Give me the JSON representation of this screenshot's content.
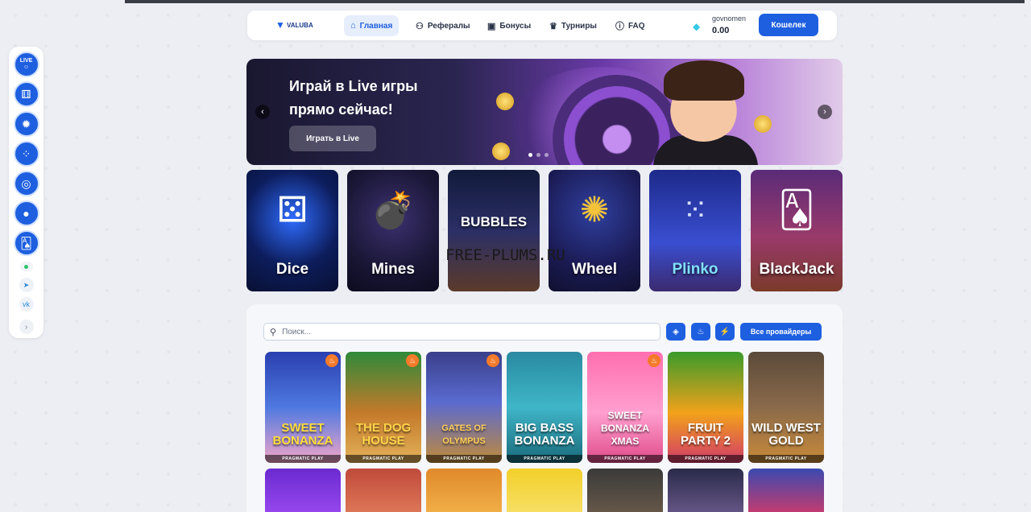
{
  "header": {
    "logo": "VALUBA",
    "nav": [
      {
        "label": "Главная",
        "icon": "home-icon"
      },
      {
        "label": "Рефералы",
        "icon": "users-icon"
      },
      {
        "label": "Бонусы",
        "icon": "gift-icon"
      },
      {
        "label": "Турниры",
        "icon": "trophy-icon"
      },
      {
        "label": "FAQ",
        "icon": "question-icon"
      }
    ],
    "user": {
      "name": "govnomen",
      "balance": "0.00"
    },
    "wallet_label": "Кошелек"
  },
  "sidebar": {
    "live_label": "LIVE",
    "items": [
      "live-icon",
      "dice-icon",
      "gear-icon",
      "bubbles-icon",
      "ring-icon",
      "ball-icon",
      "cards-icon"
    ],
    "social": [
      "telegram-icon",
      "vk-icon"
    ]
  },
  "banner": {
    "title": "Играй в Live игры прямо сейчас!",
    "button": "Играть в Live"
  },
  "categories": [
    {
      "label": "Dice"
    },
    {
      "label": "Mines"
    },
    {
      "label": "BUBBLES"
    },
    {
      "label": "Wheel"
    },
    {
      "label": "Plinko"
    },
    {
      "label": "BlackJack"
    }
  ],
  "watermark": "FREE-PLUMS.RU",
  "games_panel": {
    "search_placeholder": "Поиск...",
    "providers_label": "Все провайдеры",
    "games": [
      {
        "title": "SWEET BONANZA",
        "provider": "PRAGMATIC PLAY",
        "hot": true
      },
      {
        "title": "THE DOG HOUSE",
        "provider": "PRAGMATIC PLAY",
        "hot": true
      },
      {
        "title": "GATES OF OLYMPUS",
        "provider": "PRAGMATIC PLAY",
        "hot": true
      },
      {
        "title": "BIG BASS BONANZA",
        "provider": "PRAGMATIC PLAY",
        "hot": false
      },
      {
        "title": "SWEET BONANZA XMAS",
        "provider": "PRAGMATIC PLAY",
        "hot": true
      },
      {
        "title": "FRUIT PARTY 2",
        "provider": "PRAGMATIC PLAY",
        "hot": false
      },
      {
        "title": "WILD WEST GOLD",
        "provider": "PRAGMATIC PLAY",
        "hot": false
      }
    ]
  }
}
